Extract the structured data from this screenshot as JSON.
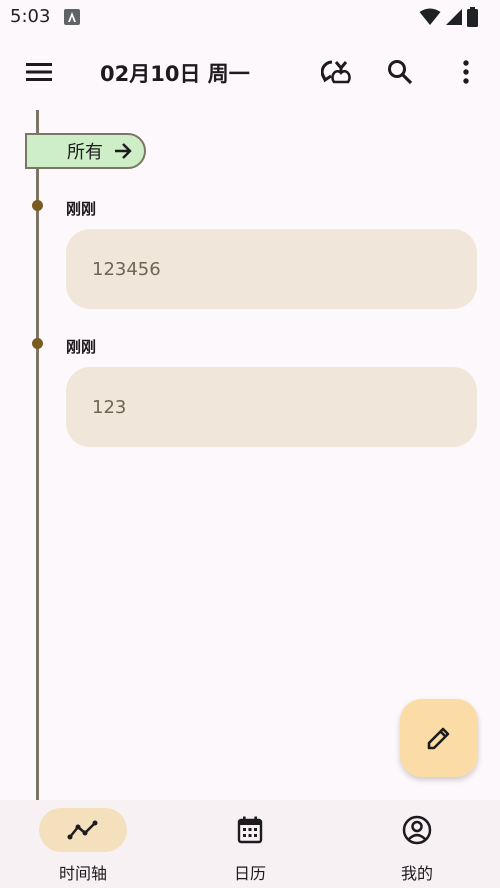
{
  "status_bar": {
    "time": "5:03"
  },
  "header": {
    "title": "02月10日 周一"
  },
  "timeline": {
    "filter_chip": {
      "label": "所有"
    },
    "entries": [
      {
        "time": "刚刚",
        "text": "123456"
      },
      {
        "time": "刚刚",
        "text": "123"
      }
    ]
  },
  "bottom_nav": {
    "items": [
      {
        "label": "时间轴",
        "icon": "timeline-icon",
        "selected": true
      },
      {
        "label": "日历",
        "icon": "calendar-icon",
        "selected": false
      },
      {
        "label": "我的",
        "icon": "account-circle-icon",
        "selected": false
      }
    ]
  },
  "colors": {
    "background": "#fdf8fb",
    "timeline_line": "#7c7566",
    "timeline_dot": "#7a5c22",
    "filter_chip": "#cdeec7",
    "card": "#f0e6d9",
    "fab": "#fcdca6",
    "nav_selected_pill": "#f5e0be"
  }
}
